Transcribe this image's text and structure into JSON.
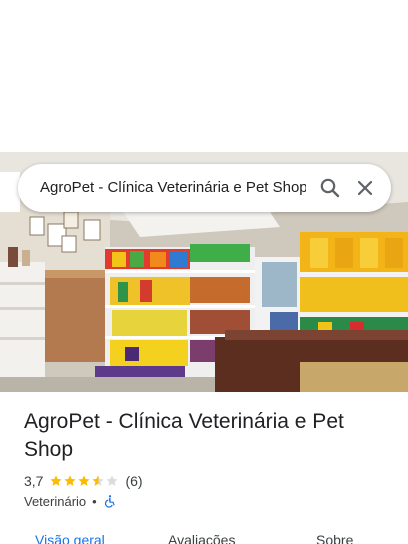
{
  "search": {
    "query": "AgroPet - Clínica Veterinária e Pet Shop"
  },
  "place": {
    "title": "AgroPet - Clínica Veterinária e Pet Shop",
    "rating_text": "3,7",
    "rating_value": 3.7,
    "review_count": "(6)",
    "category": "Veterinário",
    "separator": "•"
  },
  "tabs": [
    {
      "label": "Visão geral",
      "active": true
    },
    {
      "label": "Avaliações",
      "active": false
    },
    {
      "label": "Sobre",
      "active": false
    }
  ],
  "colors": {
    "accent": "#1a73e8",
    "star": "#fbbc04",
    "star_empty": "#dadce0"
  },
  "icons": {
    "search": "search-icon",
    "close": "close-icon",
    "accessibility": "wheelchair-icon"
  }
}
